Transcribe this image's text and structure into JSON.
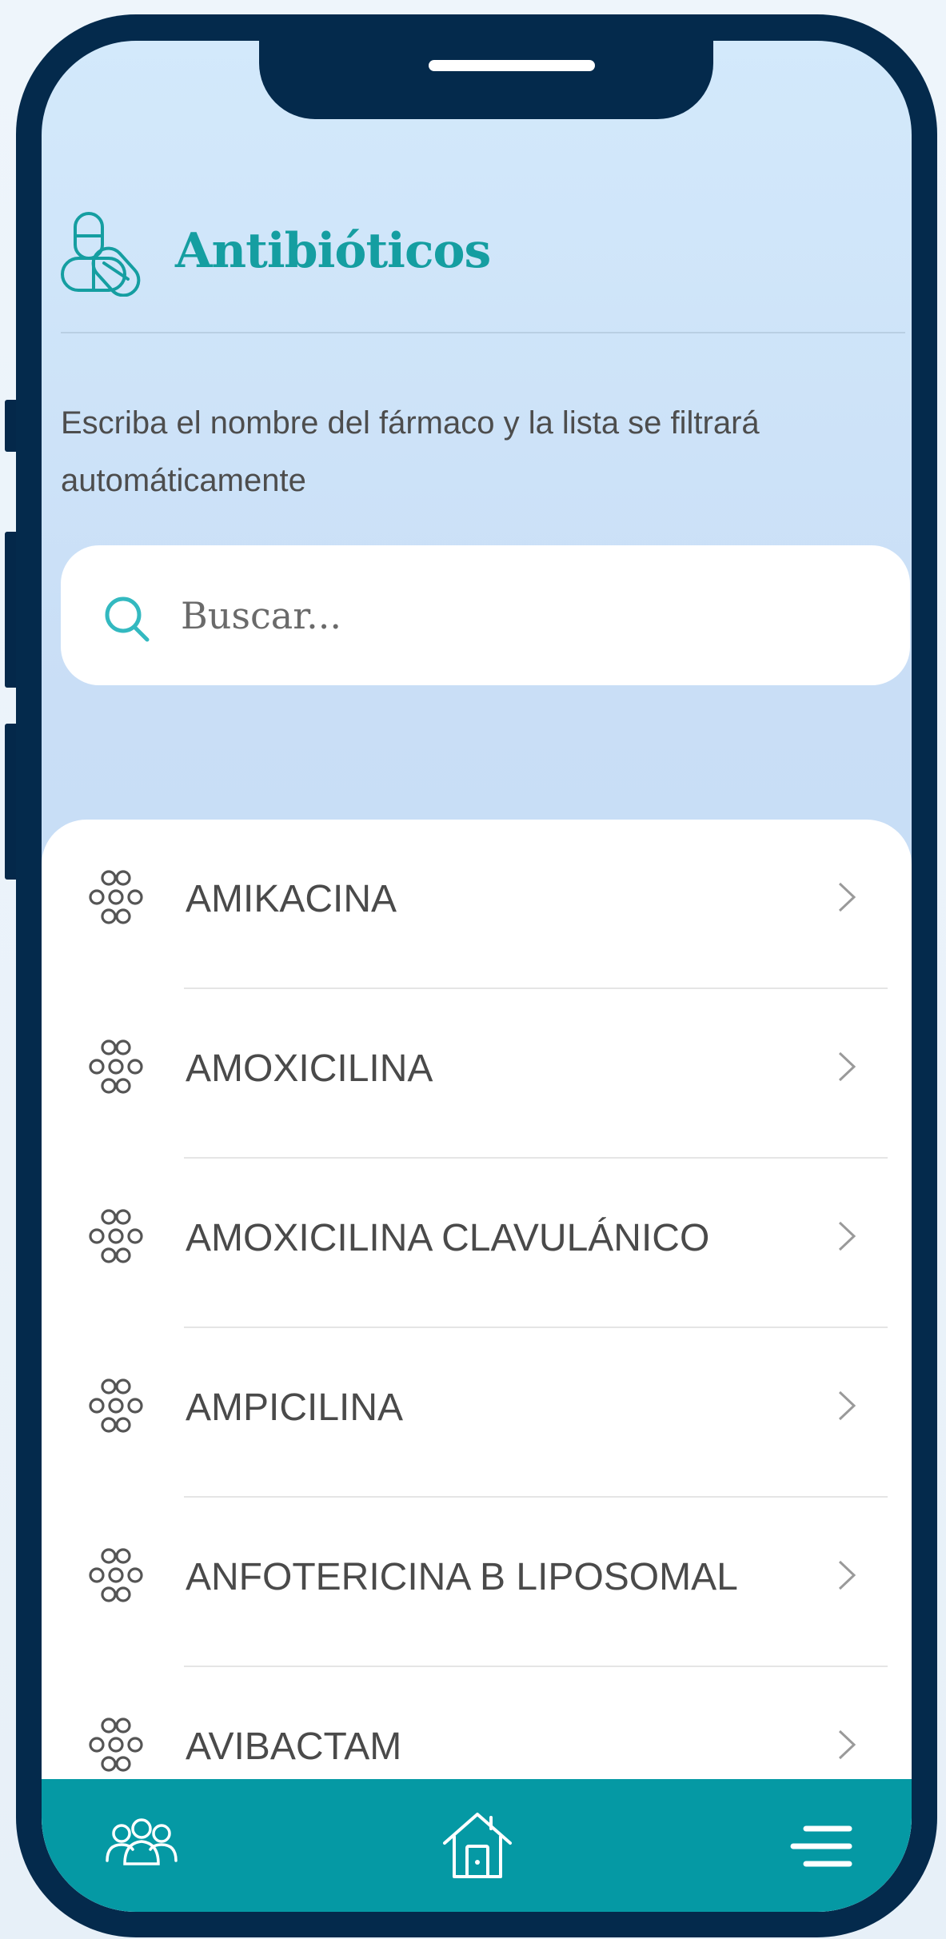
{
  "app": {
    "title": "Antibióticos",
    "instructions": "Escriba el nombre del fármaco y la lista se filtrará automáticamente"
  },
  "search": {
    "placeholder": "Buscar...",
    "value": ""
  },
  "drugs": [
    "AMIKACINA",
    "AMOXICILINA",
    "AMOXICILINA CLAVULÁNICO",
    "AMPICILINA",
    "ANFOTERICINA B LIPOSOMAL",
    "AVIBACTAM"
  ],
  "bottom_nav": {
    "items": [
      {
        "icon": "users-icon"
      },
      {
        "icon": "home-icon"
      },
      {
        "icon": "menu-icon"
      }
    ]
  },
  "colors": {
    "accent": "#159ea1",
    "frame": "#042a4c",
    "nav": "#0599a4",
    "text": "#4a4a4a"
  }
}
